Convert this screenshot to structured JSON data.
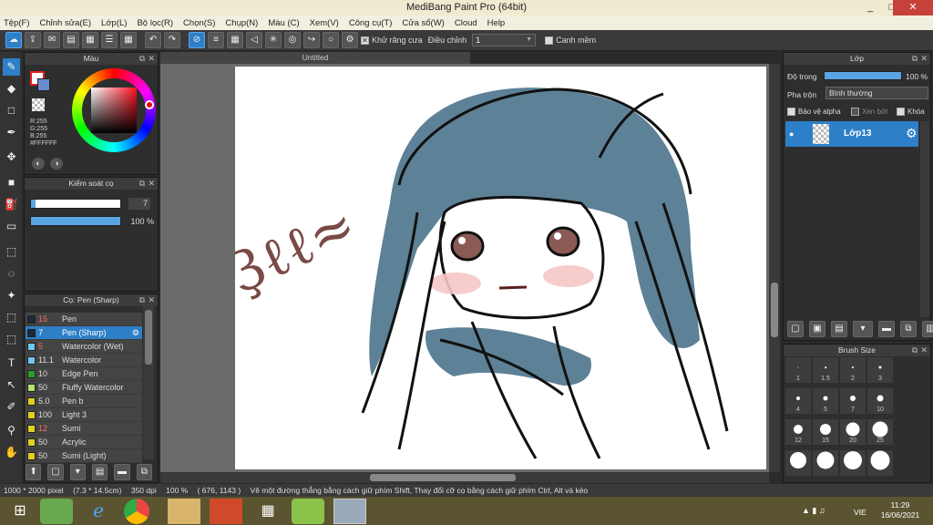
{
  "window": {
    "title": "MediBang Paint Pro (64bit)",
    "minimize": "_",
    "maximize": "□",
    "close": "✕"
  },
  "menu": [
    "Tệp(F)",
    "Chỉnh sửa(E)",
    "Lớp(L)",
    "Bộ lọc(R)",
    "Chọn(S)",
    "Chụp(N)",
    "Màu (C)",
    "Xem(V)",
    "Công cụ(T)",
    "Cửa sổ(W)",
    "Cloud",
    "Help"
  ],
  "toolbar": {
    "antialias_label": "Khử răng cưa",
    "adjust_label": "Điều chỉnh",
    "adjust_value": "1",
    "snap_label": "Canh mềm"
  },
  "color_panel": {
    "title": "Màu",
    "r": "R:255",
    "g": "G:255",
    "b": "B:255",
    "hex": "#FFFFFF"
  },
  "brush_control": {
    "title": "Kiểm soát cọ",
    "size": "7",
    "opacity": "100 %",
    "size_fraction": 0.05,
    "opacity_fraction": 1.0
  },
  "brush_list": {
    "title": "Cọ: Pen (Sharp)",
    "items": [
      {
        "size": "15",
        "name": "Pen",
        "color": "#1a2a3a",
        "size_color": "#ff6b6b"
      },
      {
        "size": "7",
        "name": "Pen (Sharp)",
        "color": "#1a2a3a",
        "size_color": "#ff6b6b",
        "selected": true
      },
      {
        "size": "5",
        "name": "Watercolor (Wet)",
        "color": "#6fc6ef",
        "size_color": "#ff6b6b"
      },
      {
        "size": "11.1",
        "name": "Watercolor",
        "color": "#6fc6ef",
        "size_color": "#dddddd"
      },
      {
        "size": "10",
        "name": "Edge Pen",
        "color": "#2aa02a",
        "size_color": "#dddddd"
      },
      {
        "size": "50",
        "name": "Fluffy Watercolor",
        "color": "#b6e06a",
        "size_color": "#dddddd"
      },
      {
        "size": "5.0",
        "name": "Pen b",
        "color": "#e0d020",
        "size_color": "#dddddd"
      },
      {
        "size": "100",
        "name": "Light 3",
        "color": "#e0d020",
        "size_color": "#dddddd"
      },
      {
        "size": "12",
        "name": "Sumi",
        "color": "#e0d020",
        "size_color": "#ff6b6b"
      },
      {
        "size": "50",
        "name": "Acrylic",
        "color": "#e0d020",
        "size_color": "#dddddd"
      },
      {
        "size": "50",
        "name": "Sumi (Light)",
        "color": "#e0d020",
        "size_color": "#dddddd"
      }
    ]
  },
  "document": {
    "tab": "Untitled"
  },
  "layer_panel": {
    "title": "Lớp",
    "opacity_label": "Độ trong",
    "opacity_value": "100 %",
    "blend_label": "Pha trộn",
    "blend_value": "Bình thường",
    "protect_alpha": "Bảo vệ alpha",
    "clip": "Xén bớt",
    "lock": "Khóa",
    "layer_name": "Lớp13"
  },
  "brush_size": {
    "title": "Brush Size",
    "sizes": [
      "1",
      "1.5",
      "2",
      "3",
      "4",
      "5",
      "7",
      "10",
      "12",
      "15",
      "20",
      "25",
      "",
      "",
      "",
      ""
    ]
  },
  "status": {
    "dimensions": "1000 * 2000 pixel",
    "physical": "(7.3 * 14.5cm)",
    "dpi": "350 dpi",
    "zoom": "100 %",
    "cursor": "( 676, 1143 )",
    "hint": "Vẽ một đường thẳng bằng cách giữ phím Shift, Thay đổi cỡ cọ bằng cách giữ phím Ctrl, Alt và kéo"
  },
  "taskbar": {
    "lang": "VIE",
    "time": "11:29",
    "date": "16/06/2021"
  },
  "colors": {
    "accent": "#2d7fc7",
    "hair": "#5d8196",
    "signature": "#7a4a46",
    "blush": "#f6c6c8"
  }
}
